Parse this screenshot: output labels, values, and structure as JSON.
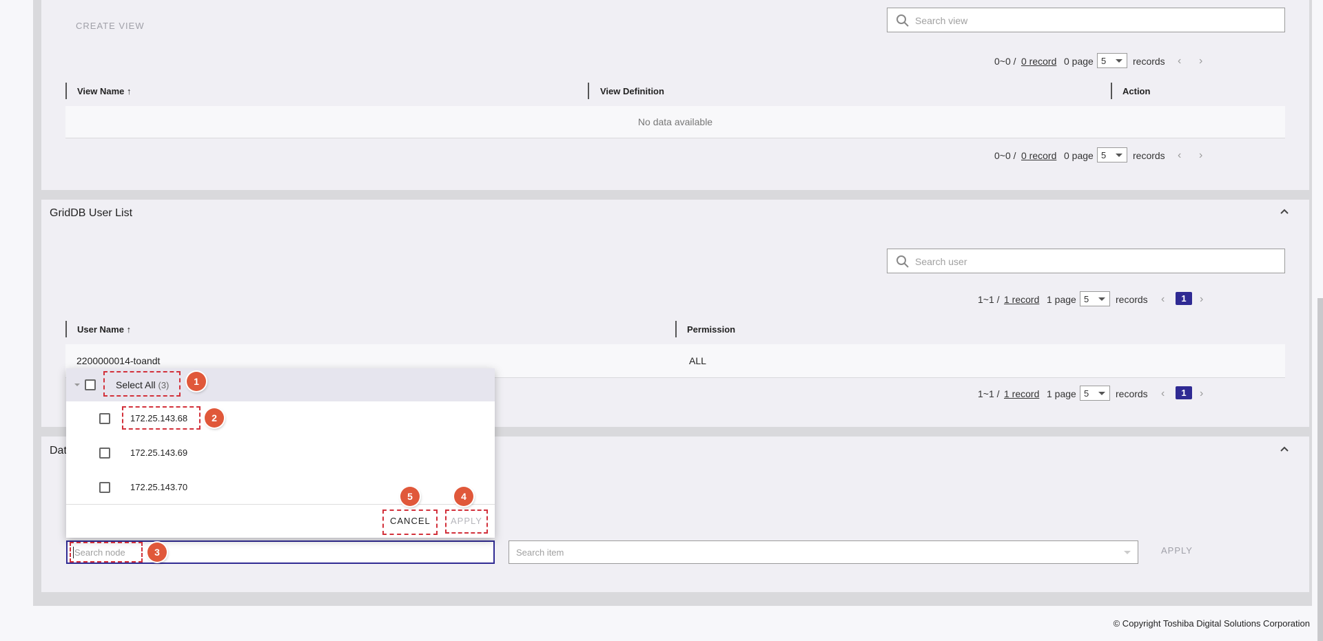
{
  "views": {
    "create_label": "CREATE VIEW",
    "search_placeholder": "Search view",
    "pager_top": {
      "range": "0~0 / ",
      "records_link": "0 record",
      "pages": "0 page",
      "page_size": "5",
      "records_label": "records"
    },
    "columns": [
      "View Name",
      "View Definition",
      "Action"
    ],
    "empty_text": "No data available",
    "pager_bottom": {
      "range": "0~0 / ",
      "records_link": "0 record",
      "pages": "0 page",
      "page_size": "5",
      "records_label": "records"
    }
  },
  "users": {
    "title": "GridDB User List",
    "search_placeholder": "Search user",
    "pager_top": {
      "range": "1~1 / ",
      "records_link": "1 record",
      "pages": "1 page",
      "page_size": "5",
      "records_label": "records",
      "current_page": "1"
    },
    "columns": [
      "User Name",
      "Permission"
    ],
    "rows": [
      {
        "name": "2200000014-toandt",
        "permission": "ALL"
      }
    ],
    "pager_bottom": {
      "range": "1~1 / ",
      "records_link": "1 record",
      "pages": "1 page",
      "page_size": "5",
      "records_label": "records",
      "current_page": "1"
    }
  },
  "data_section": {
    "title_partial": "Dat",
    "search_node_placeholder": "Search node",
    "search_item_placeholder": "Search item",
    "apply_label": "APPLY"
  },
  "node_dropdown": {
    "select_all_label": "Select All",
    "select_all_count": "(3)",
    "nodes": [
      "172.25.143.68",
      "172.25.143.69",
      "172.25.143.70"
    ],
    "cancel_label": "CANCEL",
    "apply_label": "APPLY"
  },
  "annotations": [
    "1",
    "2",
    "3",
    "4",
    "5"
  ],
  "footer": {
    "copyright": "© Copyright Toshiba Digital Solutions Corporation"
  },
  "colors": {
    "accent": "#2f2a93",
    "annotation": "#e0583a",
    "annotation_border": "#d2303a"
  }
}
